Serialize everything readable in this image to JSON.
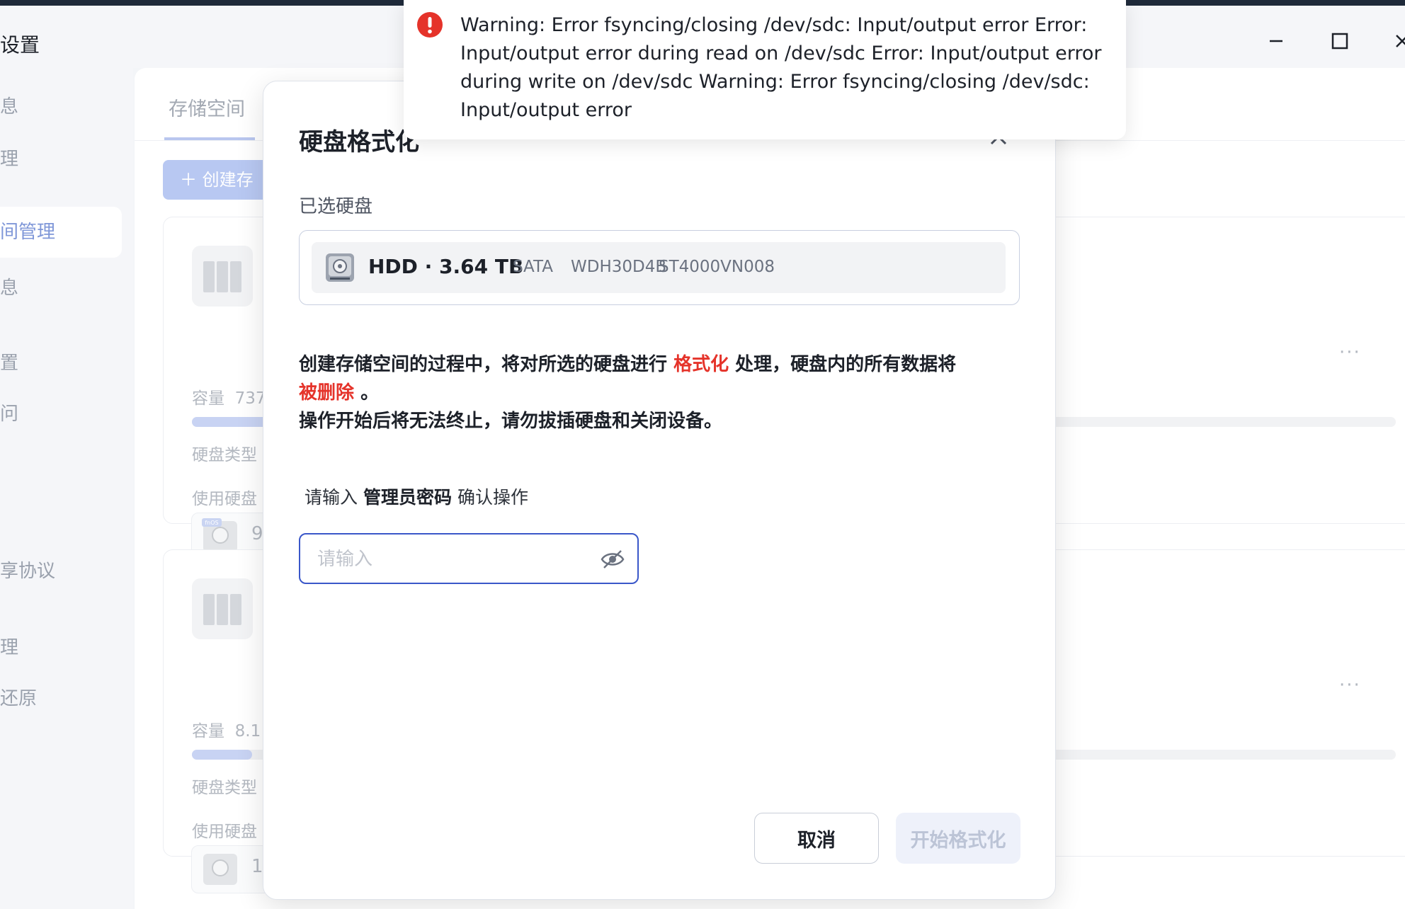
{
  "window": {
    "title": "设置"
  },
  "sidebar": {
    "items": [
      {
        "label": "息"
      },
      {
        "label": "理"
      },
      {
        "label": "间管理"
      },
      {
        "label": "息"
      },
      {
        "label": "置"
      },
      {
        "label": "问"
      },
      {
        "label": "享协议"
      },
      {
        "label": "理"
      },
      {
        "label": "还原"
      }
    ]
  },
  "main": {
    "tab_label": "存储空间",
    "create_button": "创建存",
    "cards": [
      {
        "capacity_label": "容量",
        "capacity_value": "737",
        "usage_fraction": 0.69,
        "disk_type_label": "硬盘类型",
        "used_disk_label": "使用硬盘",
        "disk_value": "9",
        "disk_badge": "fnOS",
        "more": "···"
      },
      {
        "capacity_label": "容量",
        "capacity_value": "8.1",
        "usage_fraction": 0.05,
        "disk_type_label": "硬盘类型",
        "used_disk_label": "使用硬盘",
        "disk_value": "1",
        "more": "···"
      }
    ]
  },
  "modal": {
    "title": "硬盘格式化",
    "selected_label": "已选硬盘",
    "disk": {
      "name": "HDD · 3.64 TB",
      "interface": "SATA",
      "serial": "WDH30D4B",
      "model": "ST4000VN008"
    },
    "warning": {
      "part1": "创建存储空间的过程中，将对所选的硬盘进行",
      "highlight1": "格式化",
      "part2": "处理，硬盘内的所有数据将",
      "highlight2": "被删除",
      "part3": "。",
      "line2": "操作开始后将无法终止，请勿拔插硬盘和关闭设备。"
    },
    "password": {
      "prefix": "请输入",
      "bold": "管理员密码",
      "suffix": "确认操作",
      "placeholder": "请输入",
      "value": ""
    },
    "cancel_button": "取消",
    "start_button": "开始格式化"
  },
  "toast": {
    "message": "Warning: Error fsyncing/closing /dev/sdc: Input/output error Error: Input/output error during read on /dev/sdc Error: Input/output error during write on /dev/sdc Warning: Error fsyncing/closing /dev/sdc: Input/output error",
    "color": "#e5332a"
  },
  "colors": {
    "accent": "#3a57c9",
    "danger": "#e5332a"
  }
}
